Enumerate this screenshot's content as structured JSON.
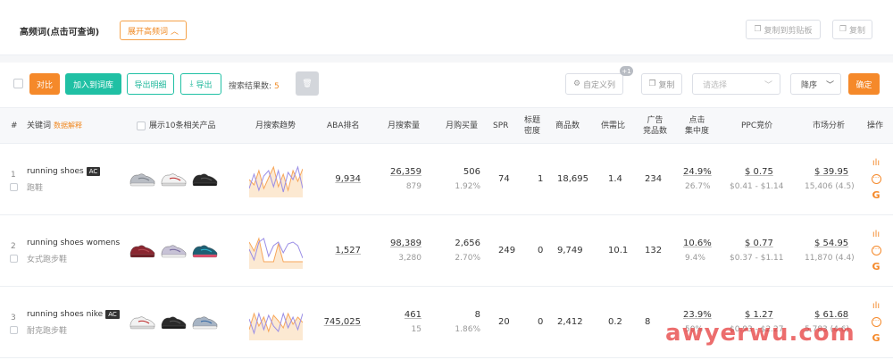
{
  "header": {
    "title": "高频词(点击可查询)",
    "expand_label": "展开高频词",
    "copy_clipboard_label": "复制到剪贴板",
    "copy_label": "复制"
  },
  "toolbar": {
    "compare_label": "对比",
    "add_lib_label": "加入到词库",
    "export_detail_label": "导出明细",
    "export_label": "导出",
    "result_label": "搜索结果数:",
    "result_count": "5",
    "custom_col_label": "自定义列",
    "custom_badge": "+1",
    "copy_label": "复制",
    "select_placeholder": "请选择",
    "order_value": "降序",
    "confirm_label": "确定"
  },
  "columns": {
    "hash": "#",
    "keyword": "关键词",
    "data_explain": "数据解释",
    "show_products": "展示10条相关产品",
    "trend": "月搜索趋势",
    "aba": "ABA排名",
    "monthly_search": "月搜索量",
    "monthly_buy": "月购买量",
    "spr": "SPR",
    "title_density_1": "标题",
    "title_density_2": "密度",
    "products": "商品数",
    "supply_ratio": "供需比",
    "ad_products_1": "广告",
    "ad_products_2": "竞品数",
    "click_conc_1": "点击",
    "click_conc_2": "集中度",
    "ppc": "PPC竞价",
    "market": "市场分析",
    "ops": "操作"
  },
  "rows": [
    {
      "index": "1",
      "keyword": "running shoes",
      "badge": "AC",
      "keyword_cn": "跑鞋",
      "aba": "9,934",
      "search": "26,359",
      "search_sub": "879",
      "buy": "506",
      "buy_pct": "1.92%",
      "spr": "74",
      "density": "1",
      "products": "18,695",
      "supply": "1.4",
      "ad": "234",
      "click": "24.9%",
      "click_sub": "26.7%",
      "ppc": "$ 0.75",
      "ppc_range": "$0.41 - $1.14",
      "market": "$ 39.95",
      "market_sub": "15,406 (4.5)",
      "shoes": [
        "grey",
        "white",
        "black"
      ],
      "trend": {
        "orange": [
          20,
          14,
          30,
          10,
          22,
          34,
          12,
          26,
          8,
          30,
          18,
          32
        ],
        "purple": [
          10,
          26,
          8,
          24,
          30,
          12,
          30,
          6,
          28,
          20,
          34,
          10
        ]
      }
    },
    {
      "index": "2",
      "keyword": "running shoes womens",
      "badge": "",
      "keyword_cn": "女式跑步鞋",
      "aba": "1,527",
      "search": "98,389",
      "search_sub": "3,280",
      "buy": "2,656",
      "buy_pct": "2.70%",
      "spr": "249",
      "density": "0",
      "products": "9,749",
      "supply": "10.1",
      "ad": "132",
      "click": "10.6%",
      "click_sub": "9.4%",
      "ppc": "$ 0.77",
      "ppc_range": "$0.37 - $1.11",
      "market": "$ 54.95",
      "market_sub": "11,870 (4.4)",
      "shoes": [
        "maroon",
        "lavender",
        "teal"
      ],
      "trend": {
        "orange": [
          30,
          20,
          34,
          8,
          8,
          8,
          28,
          8,
          8,
          8,
          8,
          8
        ],
        "purple": [
          22,
          10,
          30,
          34,
          14,
          26,
          30,
          18,
          28,
          30,
          26,
          12
        ]
      }
    },
    {
      "index": "3",
      "keyword": "running shoes nike",
      "badge": "AC",
      "keyword_cn": "耐克跑步鞋",
      "aba": "745,025",
      "search": "461",
      "search_sub": "15",
      "buy": "8",
      "buy_pct": "1.86%",
      "spr": "20",
      "density": "0",
      "products": "2,412",
      "supply": "0.2",
      "ad": "8",
      "click": "23.9%",
      "click_sub": "50%",
      "ppc": "$ 1.27",
      "ppc_range": "$0.93 - $2.27",
      "market": "$ 61.68",
      "market_sub": "5,783 (4.6)",
      "shoes": [
        "white",
        "black",
        "greyblue"
      ],
      "trend": {
        "orange": [
          12,
          30,
          16,
          26,
          10,
          28,
          22,
          14,
          30,
          18,
          26,
          20
        ],
        "purple": [
          24,
          8,
          30,
          12,
          28,
          16,
          10,
          30,
          14,
          26,
          12,
          30
        ]
      }
    }
  ],
  "colors": {
    "accent_orange": "#f5892a",
    "accent_teal": "#20c0a4",
    "trend_orange": "#f7a65a",
    "trend_purple": "#9a8ee6",
    "watermark": "#e63c3c"
  },
  "watermark": "awyerwu.com"
}
